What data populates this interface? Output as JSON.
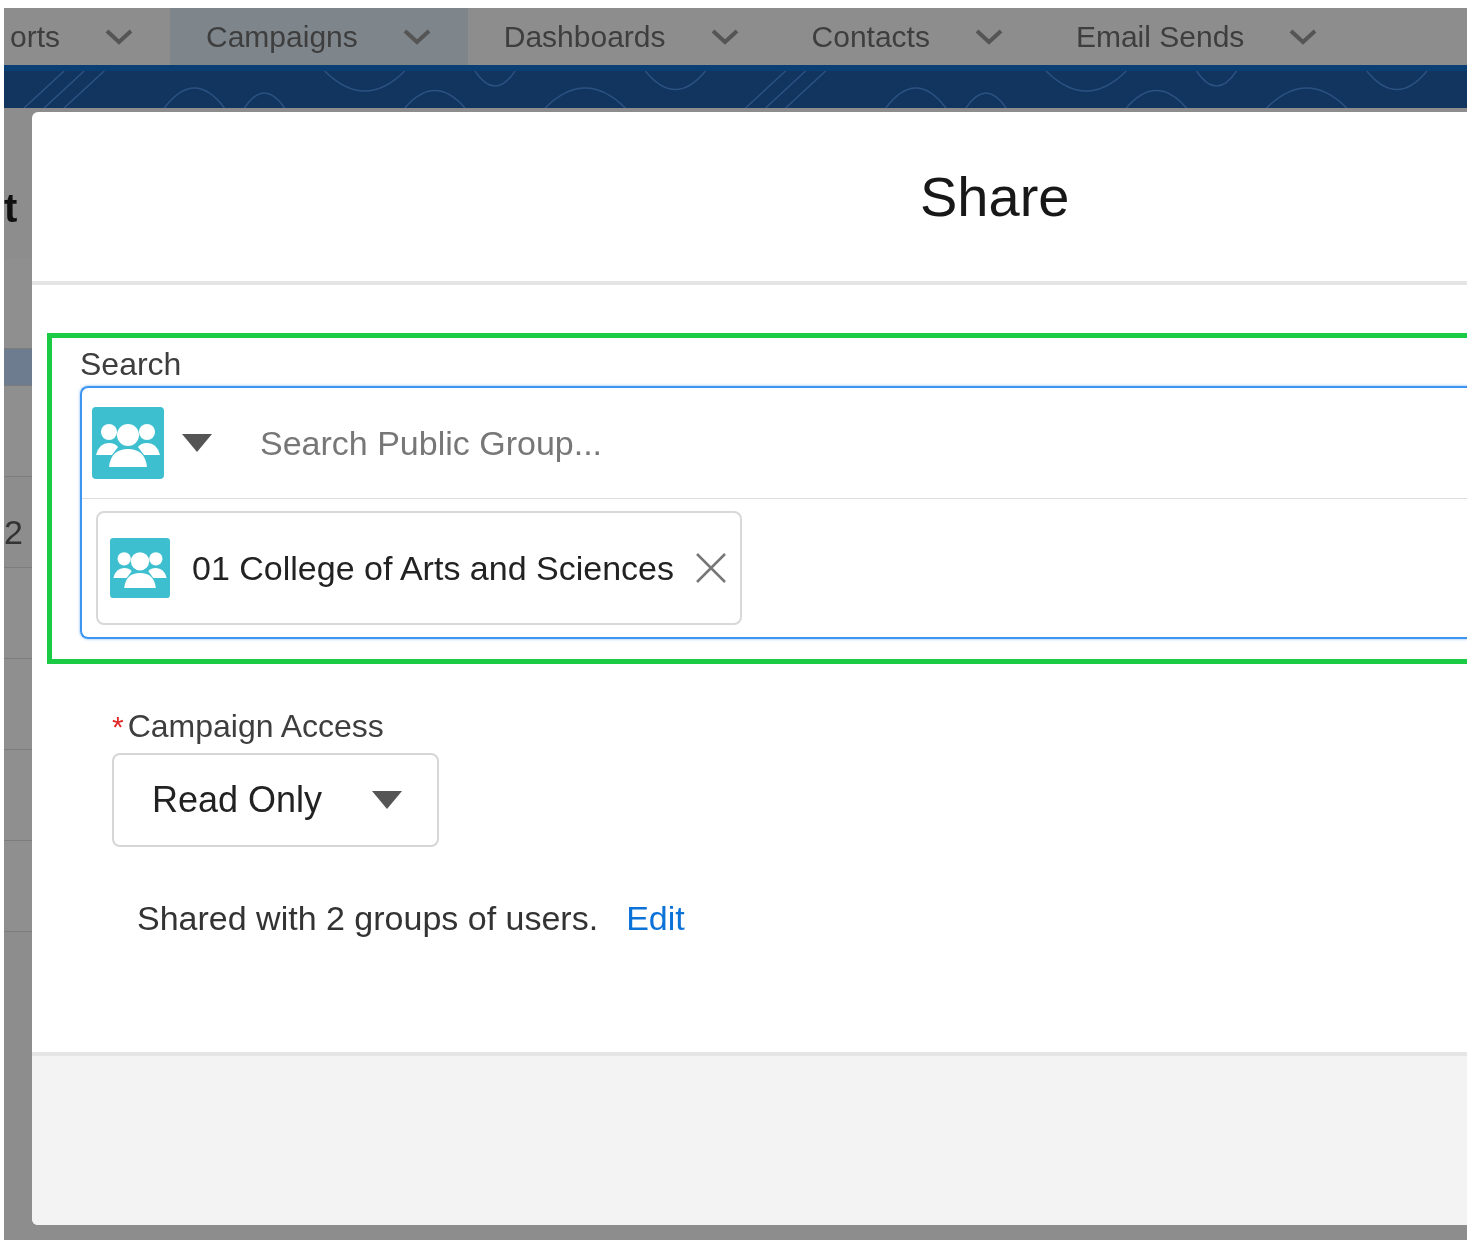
{
  "nav_tabs": [
    {
      "label": "orts",
      "selected": false
    },
    {
      "label": "Campaigns",
      "selected": true
    },
    {
      "label": "Dashboards",
      "selected": false
    },
    {
      "label": "Contacts",
      "selected": false
    },
    {
      "label": "Email Sends",
      "selected": false
    }
  ],
  "background": {
    "title_fragment": "t",
    "cell_fragment": "2"
  },
  "dialog": {
    "title": "Share",
    "highlighted": true,
    "search": {
      "label": "Search",
      "placeholder": "Search Public Group...",
      "pills": [
        {
          "label": "01 College of Arts and Sciences"
        }
      ]
    },
    "access": {
      "required_mark": "*",
      "label": "Campaign Access",
      "value": "Read Only"
    },
    "summary": "Shared with 2 groups of users.",
    "edit_link": "Edit"
  }
}
